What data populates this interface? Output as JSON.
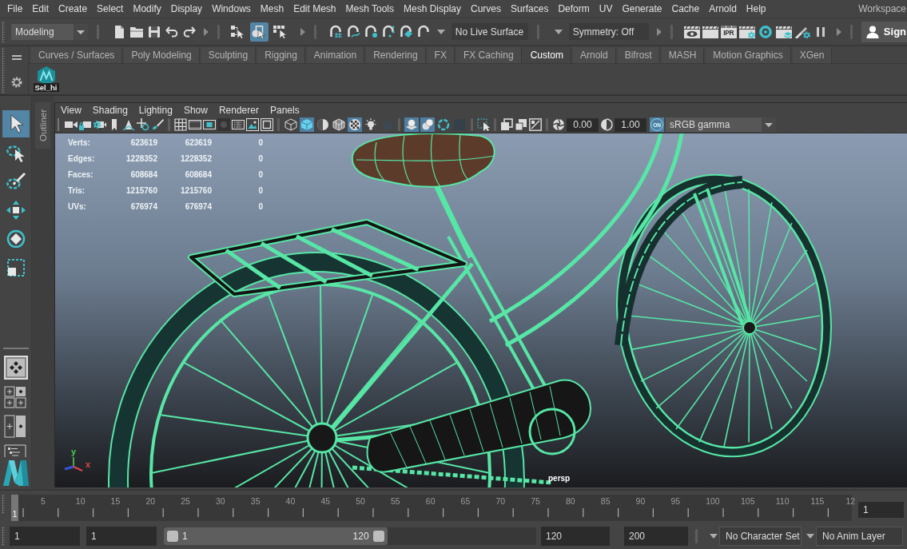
{
  "menu_bar": {
    "items": [
      "File",
      "Edit",
      "Create",
      "Select",
      "Modify",
      "Display",
      "Windows",
      "Mesh",
      "Edit Mesh",
      "Mesh Tools",
      "Mesh Display",
      "Curves",
      "Surfaces",
      "Deform",
      "UV",
      "Generate",
      "Cache",
      "Arnold",
      "Help"
    ],
    "workspace": "Workspace"
  },
  "status_line": {
    "menu_set": "Modeling",
    "selection_modes": [
      {
        "kind": "hierarchy",
        "selected": false
      },
      {
        "kind": "object",
        "selected": true
      },
      {
        "kind": "component",
        "selected": false
      }
    ],
    "live_surface": "No Live Surface",
    "symmetry": "Symmetry: Off",
    "ipr_label": "IPR",
    "sign_in": "Sign"
  },
  "shelf": {
    "tabs": [
      {
        "label": "Curves / Surfaces",
        "selected": false
      },
      {
        "label": "Poly Modeling",
        "selected": false
      },
      {
        "label": "Sculpting",
        "selected": false
      },
      {
        "label": "Rigging",
        "selected": false
      },
      {
        "label": "Animation",
        "selected": false
      },
      {
        "label": "Rendering",
        "selected": false
      },
      {
        "label": "FX",
        "selected": false
      },
      {
        "label": "FX Caching",
        "selected": false
      },
      {
        "label": "Custom",
        "selected": true
      },
      {
        "label": "Arnold",
        "selected": false
      },
      {
        "label": "Bifrost",
        "selected": false
      },
      {
        "label": "MASH",
        "selected": false
      },
      {
        "label": "Motion Graphics",
        "selected": false
      },
      {
        "label": "XGen",
        "selected": false
      }
    ],
    "items": [
      {
        "label": "Sel_hi"
      }
    ]
  },
  "tool_box": {
    "tools": [
      {
        "kind": "select",
        "selected": true
      },
      {
        "kind": "lasso",
        "selected": false
      },
      {
        "kind": "paint",
        "selected": false
      },
      {
        "kind": "move",
        "selected": false
      },
      {
        "kind": "rotate",
        "selected": false
      },
      {
        "kind": "scale",
        "selected": false
      }
    ]
  },
  "outliner_tab": "Outliner",
  "viewport": {
    "menu": [
      "View",
      "Shading",
      "Lighting",
      "Show",
      "Renderer",
      "Panels"
    ],
    "toolbar": {
      "shading_toggles": [
        {
          "kind": "wireframe",
          "on": false
        },
        {
          "kind": "smooth-shade",
          "on": true
        },
        {
          "kind": "default-material",
          "on": false
        },
        {
          "kind": "wireframe-on-shaded",
          "on": false
        },
        {
          "kind": "textured",
          "on": true
        },
        {
          "kind": "lights",
          "on": false
        },
        {
          "kind": "shadows",
          "on": false
        }
      ],
      "render_toggles": [
        {
          "kind": "xray",
          "on": true
        },
        {
          "kind": "xray-joints",
          "on": true
        },
        {
          "kind": "ambient-occlusion",
          "on": false
        },
        {
          "kind": "anti-aliasing",
          "on": false
        }
      ],
      "exposure": "0.00",
      "gamma": "1.00",
      "color_management": {
        "label": "ON",
        "on": true
      },
      "view_transform": "sRGB gamma"
    },
    "hud": [
      {
        "label": "Verts:",
        "values": [
          "623619",
          "623619",
          "0"
        ]
      },
      {
        "label": "Edges:",
        "values": [
          "1228352",
          "1228352",
          "0"
        ]
      },
      {
        "label": "Faces:",
        "values": [
          "608684",
          "608684",
          "0"
        ]
      },
      {
        "label": "Tris:",
        "values": [
          "1215760",
          "1215760",
          "0"
        ]
      },
      {
        "label": "UVs:",
        "values": [
          "676974",
          "676974",
          "0"
        ]
      }
    ],
    "axes": [
      {
        "label": "y",
        "color": "#4cd04c"
      },
      {
        "label": "x",
        "color": "#e04848"
      }
    ],
    "camera": "persp"
  },
  "time_slider": {
    "current_frame": "1",
    "level": 0,
    "labels": [
      "5",
      "10",
      "15",
      "20",
      "25",
      "30",
      "35",
      "40",
      "45",
      "50",
      "55",
      "60",
      "65",
      "70",
      "75",
      "80",
      "85",
      "90",
      "95",
      "100",
      "105",
      "110",
      "115",
      "12"
    ],
    "frame_field": "1"
  },
  "range_slider": {
    "start_frame": "1",
    "playback_start": "1",
    "level": 0.6,
    "range_start": "1",
    "range_end": "120",
    "playback_end": "120",
    "end_frame": "200",
    "character_set": "No Character Set",
    "anim_layer": "No Anim Layer"
  }
}
